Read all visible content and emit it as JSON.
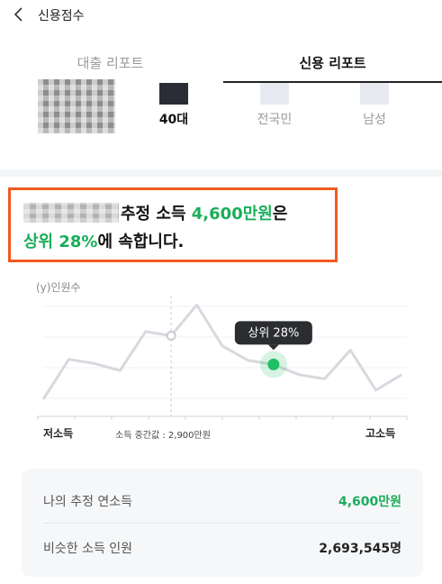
{
  "header": {
    "title": "신용점수",
    "back_icon": "chevron-left-icon"
  },
  "tabs": [
    {
      "label": "대출 리포트",
      "active": false
    },
    {
      "label": "신용 리포트",
      "active": true
    }
  ],
  "legend": [
    {
      "label": "40대",
      "color": "#2a2d35"
    },
    {
      "label": "전국민",
      "color": "#e6eaf0"
    },
    {
      "label": "남성",
      "color": "#e6eaf0"
    }
  ],
  "headline": {
    "line1_text": "추정 소득 ",
    "income": "4,600만원",
    "line1_suffix": "은",
    "percentile": "상위 28%",
    "line2_suffix": "에 속합니다."
  },
  "chart": {
    "y_label": "(y)인원수",
    "x_low_label": "저소득",
    "x_high_label": "고소득",
    "median_label": "소득 중간값 : 2,900만원",
    "marker_label": "상위 28%",
    "line_color": "#d6d9de",
    "accent": "#1fbf63"
  },
  "chart_data": {
    "type": "line",
    "series": [
      {
        "values": [
          0.06,
          0.45,
          0.41,
          0.34,
          0.72,
          0.68,
          0.98,
          0.58,
          0.44,
          0.4,
          0.3,
          0.26,
          0.54,
          0.15,
          0.3
        ]
      }
    ],
    "median_index": 5,
    "marker_index": 9
  },
  "summary": {
    "rows": [
      {
        "label": "나의 추정 연소득",
        "value": "4,600만원"
      },
      {
        "label": "비슷한 소득 인원",
        "value": "2,693,545명"
      }
    ]
  }
}
